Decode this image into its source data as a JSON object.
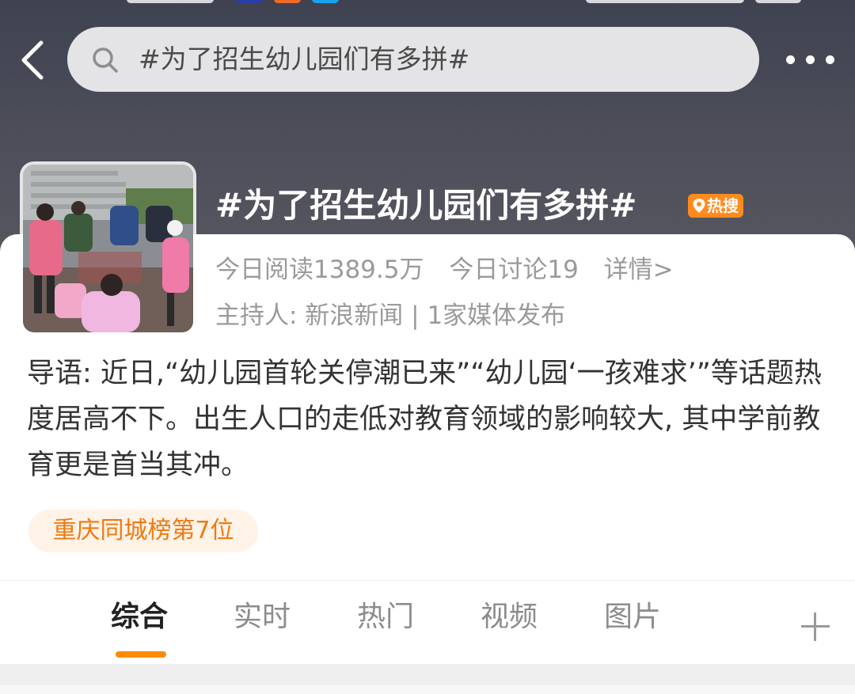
{
  "search": {
    "query": "#为了招生幼儿园们有多拼#"
  },
  "topic": {
    "title": "#为了招生幼儿园们有多拼#",
    "badge": "热搜",
    "stats": {
      "reads": "今日阅读1389.5万",
      "discussions": "今日讨论19",
      "details": "详情>"
    },
    "host": "主持人: 新浪新闻 | 1家媒体发布",
    "intro": "导语: 近日,“幼儿园首轮关停潮已来”“幼儿园‘一孩难求’”等话题热度居高不下。出生人口的走低对教育领域的影响较大, 其中学前教育更是首当其冲。",
    "rank": "重庆同城榜第7位"
  },
  "tabs": [
    {
      "label": "综合",
      "active": true
    },
    {
      "label": "实时",
      "active": false
    },
    {
      "label": "热门",
      "active": false
    },
    {
      "label": "视频",
      "active": false
    },
    {
      "label": "图片",
      "active": false
    }
  ],
  "colors": {
    "accent": "#ff8a00",
    "badge": "#ff8a1e",
    "rank_text": "#ee7a12",
    "rank_bg": "#fff2e6"
  }
}
